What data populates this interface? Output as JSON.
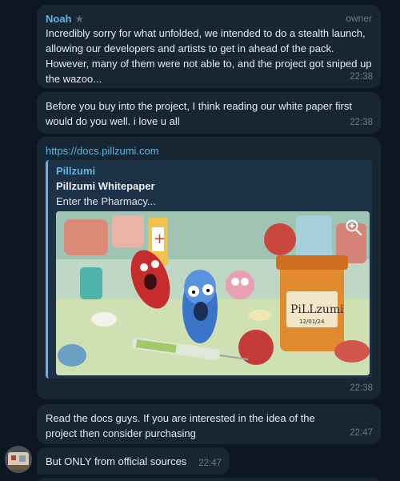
{
  "messages": [
    {
      "sender": "Noah",
      "role": "owner",
      "text": "Incredibly sorry for what unfolded, we intended to do a stealth launch, allowing our developers and artists to get in ahead of the pack. However, many of them were not able to, and the project got sniped up the wazoo...",
      "time": "22:38"
    },
    {
      "text": "Before you buy into the project, I think reading our white paper first would do you well. i love u all",
      "time": "22:38"
    },
    {
      "link": "https://docs.pillzumi.com",
      "preview": {
        "site": "Pillzumi",
        "title": "Pillzumi Whitepaper",
        "description": "Enter the Pharmacy...",
        "image_label": "PiLLzumi",
        "image_date": "12/01/24"
      },
      "time": "22:38"
    },
    {
      "text": "Read the docs guys. If you are interested in the idea of the project then consider purchasing",
      "time": "22:47"
    },
    {
      "text": "But ONLY from official sources",
      "time": "22:47"
    }
  ],
  "icons": {
    "star": "star-icon",
    "zoom": "zoom-in-icon",
    "avatar": "user-avatar"
  },
  "colors": {
    "background": "#0e1621",
    "bubble": "#182533",
    "accent": "#5fb5e3",
    "meta": "#6d7a88"
  }
}
